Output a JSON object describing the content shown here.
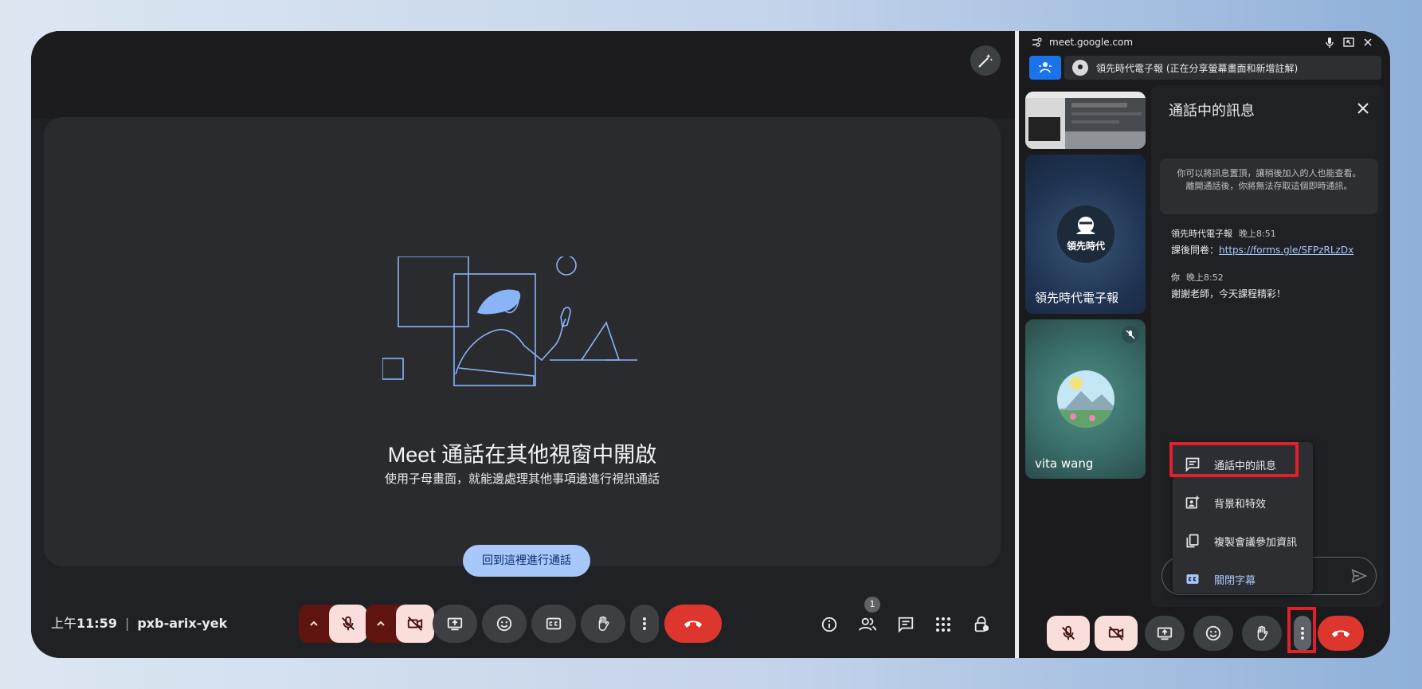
{
  "main": {
    "stage": {
      "title": "Meet 通話在其他視窗中開啟",
      "subtitle": "使用子母畫面，就能邊處理其他事項邊進行視訊通話",
      "return_button": "回到這裡進行通話"
    },
    "bottom": {
      "time_prefix": "上午",
      "time": "11:59",
      "separator": "|",
      "meeting_code": "pxb-arix-yek",
      "people_count": "1"
    }
  },
  "pip": {
    "url": "meet.google.com",
    "presenting_label": "領先時代電子報 (正在分享螢幕畫面和新增註解)",
    "tiles": [
      {
        "name": "領先時代電子報",
        "avatar_text": "領先時代"
      },
      {
        "name": "vita wang"
      }
    ],
    "chat": {
      "title": "通話中的訊息",
      "notice": "你可以將訊息置頂，讓稍後加入的人也能查看。離開通話後，你將無法存取這個即時通訊。",
      "messages": [
        {
          "sender": "領先時代電子報",
          "time": "晚上8:51",
          "prefix": "課後問卷：",
          "link": "https://forms.gle/SFPzRLzDx"
        },
        {
          "sender": "你",
          "time": "晚上8:52",
          "text": "謝謝老師，今天課程精彩！"
        }
      ]
    },
    "menu": [
      {
        "label": "通話中的訊息",
        "icon": "chat-icon"
      },
      {
        "label": "背景和特效",
        "icon": "background-effects-icon"
      },
      {
        "label": "複製會議參加資訊",
        "icon": "copy-icon"
      },
      {
        "label": "關閉字幕",
        "icon": "captions-icon"
      }
    ]
  },
  "colors": {
    "highlight": "#e0202a",
    "end_call": "#dc362e",
    "accent_blue": "#a8c7fa"
  }
}
